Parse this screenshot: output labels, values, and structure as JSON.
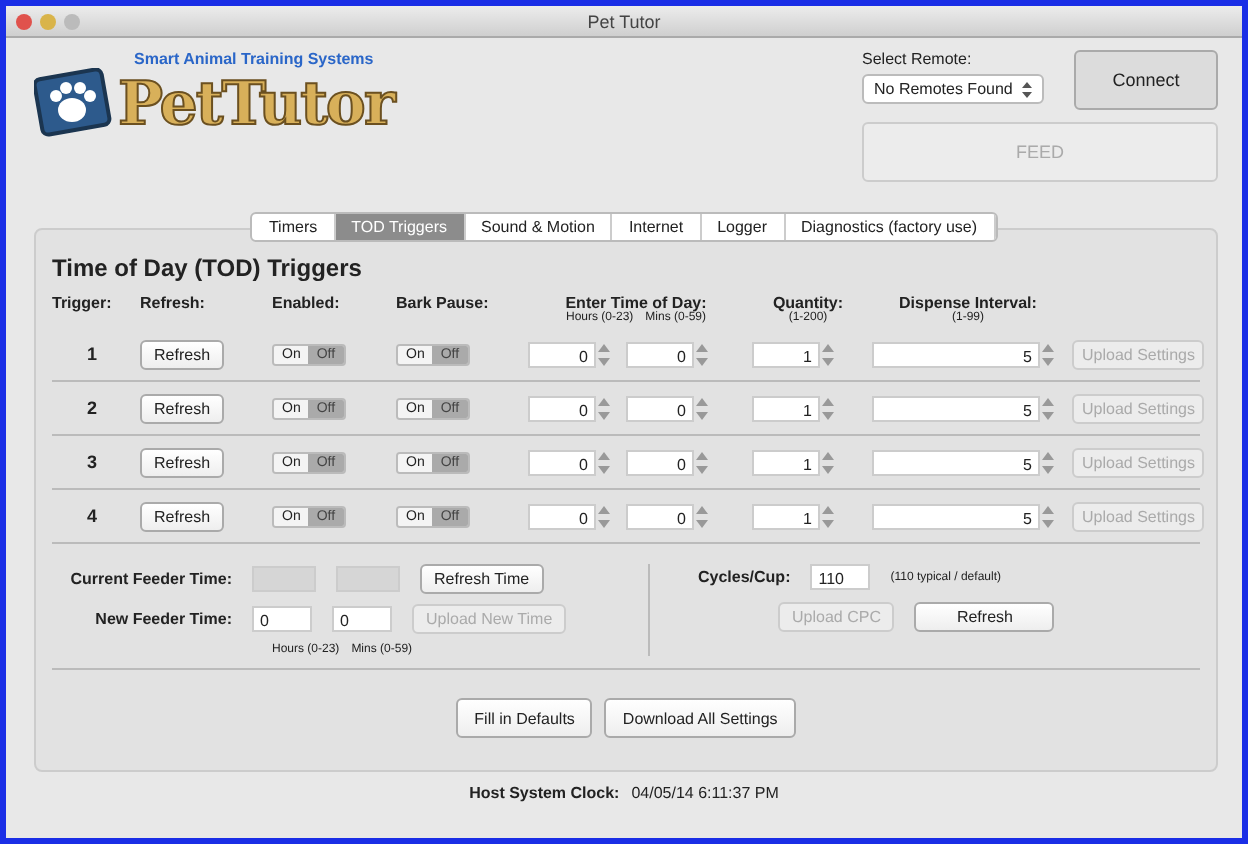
{
  "window": {
    "title": "Pet Tutor"
  },
  "logo": {
    "tagline": "Smart Animal Training Systems",
    "name": "PetTutor"
  },
  "remote": {
    "label": "Select Remote:",
    "value": "No Remotes Found",
    "connect": "Connect",
    "feed": {
      "label": "FEED",
      "disabled": true
    }
  },
  "tabs": [
    {
      "label": "Timers",
      "selected": false
    },
    {
      "label": "TOD Triggers",
      "selected": true
    },
    {
      "label": "Sound & Motion",
      "selected": false
    },
    {
      "label": "Internet",
      "selected": false
    },
    {
      "label": "Logger",
      "selected": false
    },
    {
      "label": "Diagnostics (factory use)",
      "selected": false
    }
  ],
  "heading": "Time of Day (TOD) Triggers",
  "columns": {
    "trigger": "Trigger:",
    "refresh": "Refresh:",
    "enabled": "Enabled:",
    "bark_pause": "Bark Pause:",
    "time": "Enter Time of Day:",
    "hours_hint": "Hours (0-23)",
    "mins_hint": "Mins (0-59)",
    "quantity": "Quantity:",
    "quantity_hint": "(1-200)",
    "interval": "Dispense Interval:",
    "interval_hint": "(1-99)"
  },
  "rows": [
    {
      "number": "1",
      "refresh": "Refresh",
      "enabled": {
        "on": "On",
        "off": "Off",
        "value": false
      },
      "bark_pause": {
        "on": "On",
        "off": "Off",
        "value": false
      },
      "hours": "0",
      "mins": "0",
      "quantity": "1",
      "interval": "5",
      "upload": {
        "label": "Upload Settings",
        "disabled": true
      }
    },
    {
      "number": "2",
      "refresh": "Refresh",
      "enabled": {
        "on": "On",
        "off": "Off",
        "value": false
      },
      "bark_pause": {
        "on": "On",
        "off": "Off",
        "value": false
      },
      "hours": "0",
      "mins": "0",
      "quantity": "1",
      "interval": "5",
      "upload": {
        "label": "Upload Settings",
        "disabled": true
      }
    },
    {
      "number": "3",
      "refresh": "Refresh",
      "enabled": {
        "on": "On",
        "off": "Off",
        "value": false
      },
      "bark_pause": {
        "on": "On",
        "off": "Off",
        "value": false
      },
      "hours": "0",
      "mins": "0",
      "quantity": "1",
      "interval": "5",
      "upload": {
        "label": "Upload Settings",
        "disabled": true
      }
    },
    {
      "number": "4",
      "refresh": "Refresh",
      "enabled": {
        "on": "On",
        "off": "Off",
        "value": false
      },
      "bark_pause": {
        "on": "On",
        "off": "Off",
        "value": false
      },
      "hours": "0",
      "mins": "0",
      "quantity": "1",
      "interval": "5",
      "upload": {
        "label": "Upload Settings",
        "disabled": true
      }
    }
  ],
  "feeder_time": {
    "current_label": "Current Feeder Time:",
    "refresh": "Refresh Time",
    "new_label": "New Feeder Time:",
    "new_hours": "0",
    "new_mins": "0",
    "upload": {
      "label": "Upload New Time",
      "disabled": true
    },
    "hours_hint": "Hours (0-23)",
    "mins_hint": "Mins (0-59)"
  },
  "cycles": {
    "label": "Cycles/Cup:",
    "value": "110",
    "hint": "(110 typical / default)",
    "upload": {
      "label": "Upload CPC",
      "disabled": true
    },
    "refresh": "Refresh"
  },
  "actions": [
    "Fill in Defaults",
    "Download All Settings"
  ],
  "status": {
    "label": "Host System Clock:",
    "value": "04/05/14 6:11:37 PM"
  }
}
